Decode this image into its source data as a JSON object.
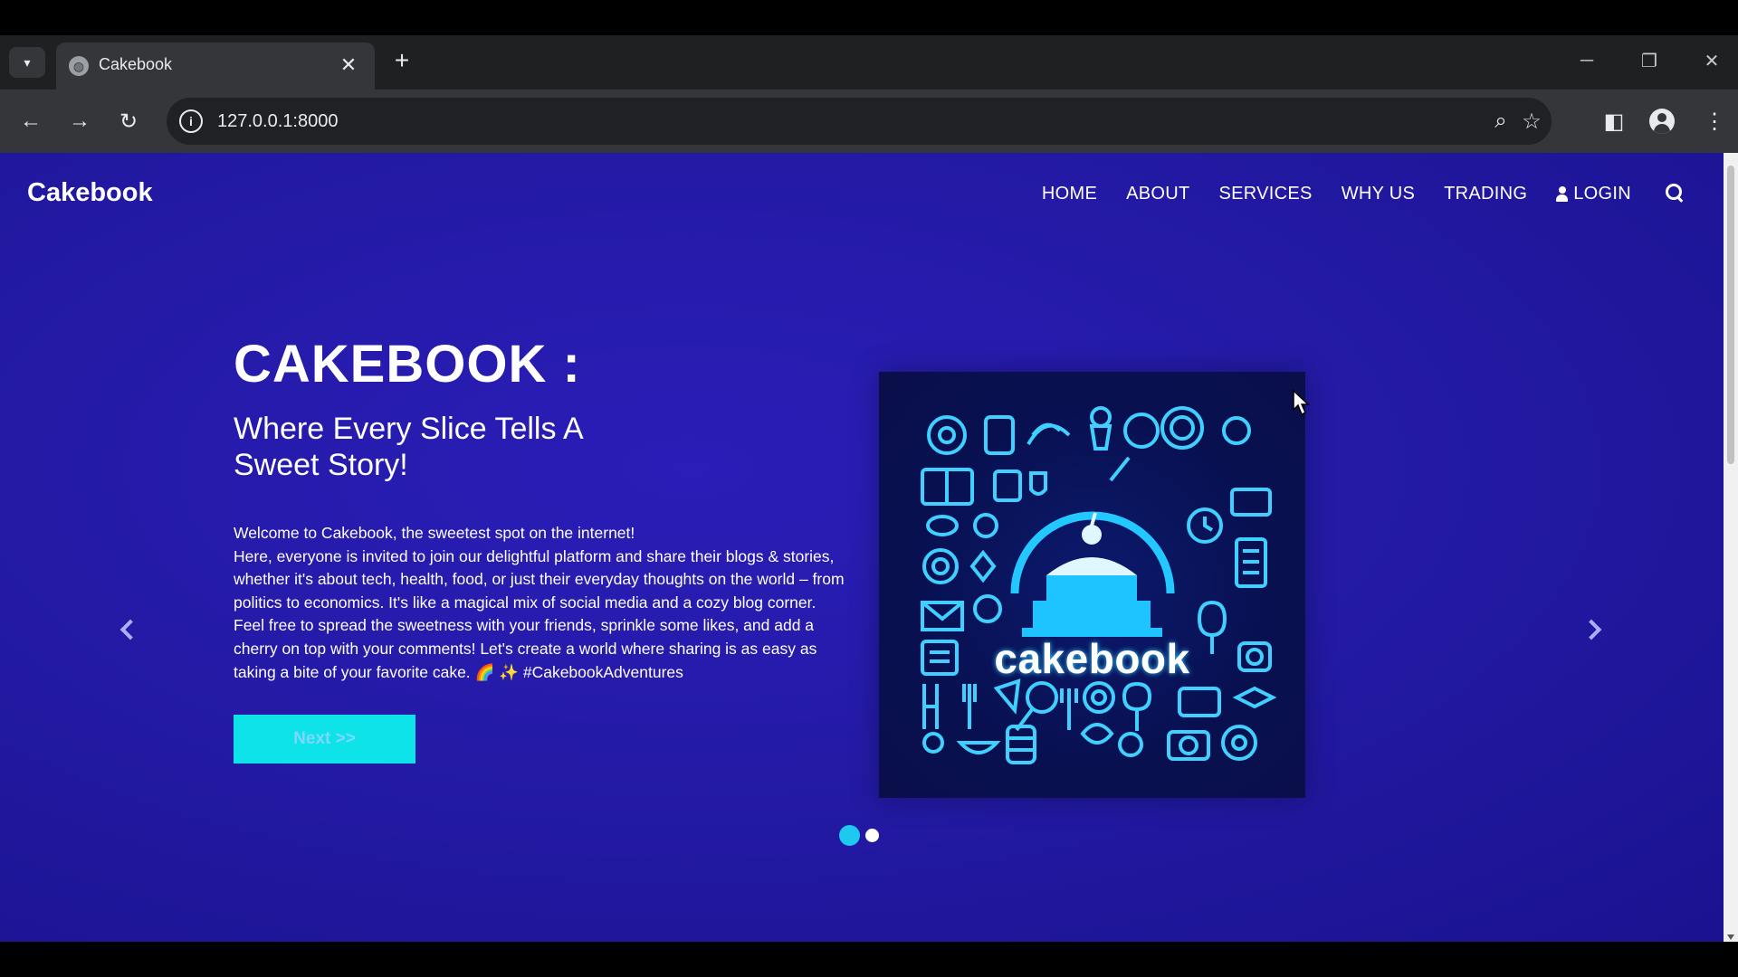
{
  "browser": {
    "tab_title": "Cakebook",
    "url": "127.0.0.1:8000"
  },
  "site": {
    "brand": "Cakebook",
    "nav": [
      "HOME",
      "ABOUT",
      "SERVICES",
      "WHY US",
      "TRADING"
    ],
    "login": "LOGIN"
  },
  "hero": {
    "title": "CAKEBOOK :",
    "subtitle": "Where Every Slice Tells A Sweet Story!",
    "description_line1": "Welcome to Cakebook, the sweetest spot on the internet!",
    "description_body": "Here, everyone is invited to join our delightful platform and share their blogs & stories, whether it's about tech, health, food, or just their everyday thoughts on the world – from politics to economics. It's like a magical mix of social media and a cozy blog corner. Feel free to spread the sweetness with your friends, sprinkle some likes, and add a cherry on top with your comments! Let's create a world where sharing is as easy as taking a bite of your favorite cake. 🌈 ✨ #CakebookAdventures",
    "next_button": "Next >>",
    "image_text": "cakebook"
  },
  "carousel": {
    "slide_count": 2,
    "active_index": 0
  },
  "colors": {
    "page_bg": "#241aa6",
    "accent": "#0fe3ea"
  }
}
